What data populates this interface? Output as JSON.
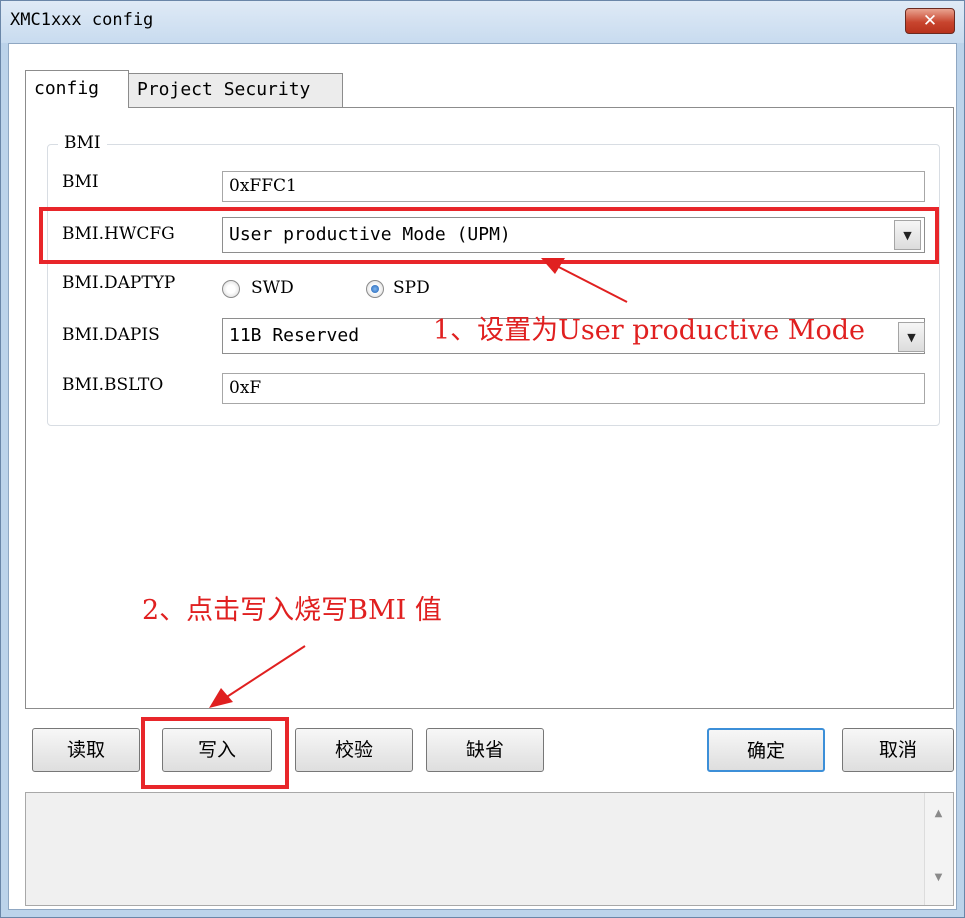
{
  "window": {
    "title": "XMC1xxx config",
    "close_glyph": "✕"
  },
  "tabs": [
    {
      "label": "config",
      "active": true
    },
    {
      "label": "Project Security",
      "active": false
    }
  ],
  "group": {
    "label": "BMI",
    "rows": {
      "bmi": {
        "label": "BMI",
        "value": "0xFFC1"
      },
      "hwcfg": {
        "label": "BMI.HWCFG",
        "value": "User productive Mode (UPM)"
      },
      "daptyp": {
        "label": "BMI.DAPTYP",
        "options": [
          "SWD",
          "SPD"
        ],
        "selected": "SPD"
      },
      "dapis": {
        "label": "BMI.DAPIS",
        "value": "11B Reserved"
      },
      "bslto": {
        "label": "BMI.BSLTO",
        "value": "0xF"
      }
    }
  },
  "annotations": {
    "step1": "1、设置为User productive Mode",
    "step2": "2、点击写入烧写BMI 值"
  },
  "buttons": {
    "read": "读取",
    "write": "写入",
    "verify": "校验",
    "default_values": "缺省",
    "ok": "确定",
    "cancel": "取消"
  },
  "colors": {
    "annotation_red": "#e8262a",
    "titlebar": "#c8dbef",
    "default_button_border": "#3c8fd8"
  },
  "icons": {
    "close": "close-icon",
    "dropdown": "chevron-down-icon",
    "scroll_up": "scroll-up-icon",
    "scroll_down": "scroll-down-icon"
  }
}
